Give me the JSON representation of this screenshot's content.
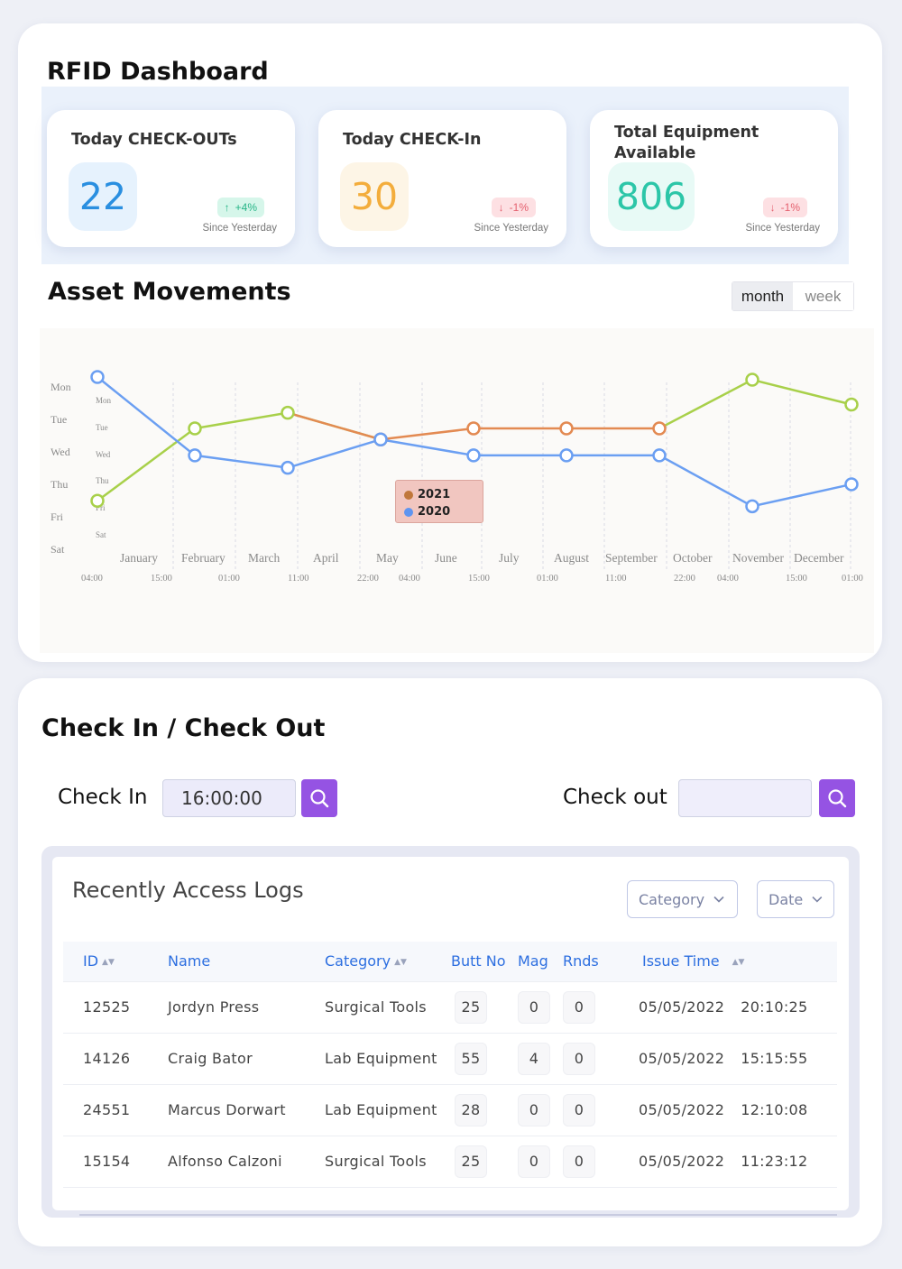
{
  "dashboard": {
    "title": "RFID Dashboard",
    "stats": [
      {
        "title": "Today CHECK-OUTs",
        "value": "22",
        "change": "+4%",
        "direction": "up",
        "since": "Since Yesterday",
        "color": "#2a8fe0",
        "bg": "#e6f2fd"
      },
      {
        "title": "Today CHECK-In",
        "value": "30",
        "change": "-1%",
        "direction": "down",
        "since": "Since Yesterday",
        "color": "#f3ad3c",
        "bg": "#fdf5e6"
      },
      {
        "title": "Total Equipment Available",
        "value": "806",
        "change": "-1%",
        "direction": "down",
        "since": "Since Yesterday",
        "color": "#2cc6a8",
        "bg": "#e8faf6"
      }
    ]
  },
  "movements": {
    "title": "Asset Movements",
    "toggle": {
      "month": "month",
      "week": "week",
      "active": "month"
    },
    "tooltip": {
      "items": [
        {
          "label": "2021",
          "color": "#c0773b"
        },
        {
          "label": "2020",
          "color": "#5f95f0"
        }
      ]
    }
  },
  "chart_data": {
    "type": "line",
    "x": [
      "January",
      "February",
      "March",
      "April",
      "May",
      "June",
      "July",
      "August",
      "September",
      "October",
      "November",
      "December"
    ],
    "y_categories": [
      "Mon",
      "Tue",
      "Wed",
      "Thu",
      "Fri",
      "Sat"
    ],
    "y_inner_categories": [
      "Mon",
      "Tue",
      "Wed",
      "Thu",
      "Fri",
      "Sat"
    ],
    "time_ticks": [
      "04:00",
      "15:00",
      "01:00",
      "11:00",
      "22:00",
      "04:00",
      "15:00",
      "01:00",
      "11:00",
      "22:00",
      "04:00",
      "15:00",
      "01:00"
    ],
    "series": [
      {
        "name": "2021",
        "color": "#9ccc3a",
        "color2": "#e38a52",
        "values": [
          4.5,
          2.3,
          2.0,
          2.8,
          2.5,
          2.5,
          2.5,
          2.5,
          0.9,
          1.5
        ]
      },
      {
        "name": "2020",
        "color": "#5f95f0",
        "values": [
          0.0,
          3.1,
          3.5,
          2.5,
          3.1,
          3.1,
          3.1,
          4.8,
          3.9
        ]
      }
    ],
    "series_y": {
      "green_start": [
        108.0,
        563.0
      ],
      "blue_start": [
        108.0,
        420.0
      ]
    },
    "grid": true
  },
  "checkinout": {
    "title": "Check In / Check Out",
    "check_in_label": "Check In",
    "check_in_value": "16:00:00",
    "check_out_label": "Check out",
    "check_out_value": ""
  },
  "logs": {
    "title": "Recently Access Logs",
    "filters": {
      "category": "Category",
      "date": "Date"
    },
    "columns": {
      "id": "ID",
      "name": "Name",
      "category": "Category",
      "butt": "Butt No",
      "mag": "Mag",
      "rnds": "Rnds",
      "time": "Issue Time"
    },
    "rows": [
      {
        "id": "12525",
        "name": "Jordyn Press",
        "category": "Surgical Tools",
        "butt": "25",
        "mag": "0",
        "rnds": "0",
        "date": "05/05/2022",
        "time": "20:10:25"
      },
      {
        "id": "14126",
        "name": "Craig Bator",
        "category": "Lab Equipment",
        "butt": "55",
        "mag": "4",
        "rnds": "0",
        "date": "05/05/2022",
        "time": "15:15:55"
      },
      {
        "id": "24551",
        "name": "Marcus Dorwart",
        "category": "Lab Equipment",
        "butt": "28",
        "mag": "0",
        "rnds": "0",
        "date": "05/05/2022",
        "time": "12:10:08"
      },
      {
        "id": "15154",
        "name": "Alfonso Calzoni",
        "category": "Surgical Tools",
        "butt": "25",
        "mag": "0",
        "rnds": "0",
        "date": "05/05/2022",
        "time": "11:23:12"
      }
    ]
  }
}
